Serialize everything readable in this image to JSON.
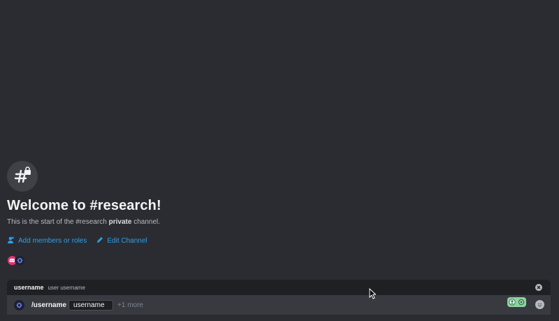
{
  "welcome": {
    "title": "Welcome to #research!",
    "subtitle_prefix": "This is the start of the #research ",
    "subtitle_bold": "private",
    "subtitle_suffix": " channel."
  },
  "actions": {
    "add_members_label": "Add members or roles",
    "edit_channel_label": "Edit Channel"
  },
  "autocomplete": {
    "option_name": "username",
    "option_description": "user username"
  },
  "composer": {
    "command_name": "/username",
    "option_value": "username",
    "more_options": "+1 more"
  },
  "colors": {
    "background": "#2b2c31",
    "link": "#2fa0e8",
    "composer": "#383a40",
    "autocomplete": "#1f2024"
  },
  "icons": {
    "channel": "hashtag-lock-icon",
    "add_members": "add-member-icon",
    "edit": "pencil-icon",
    "close": "close-icon",
    "emoji": "emoji-icon",
    "app": "bot-app-icon"
  }
}
